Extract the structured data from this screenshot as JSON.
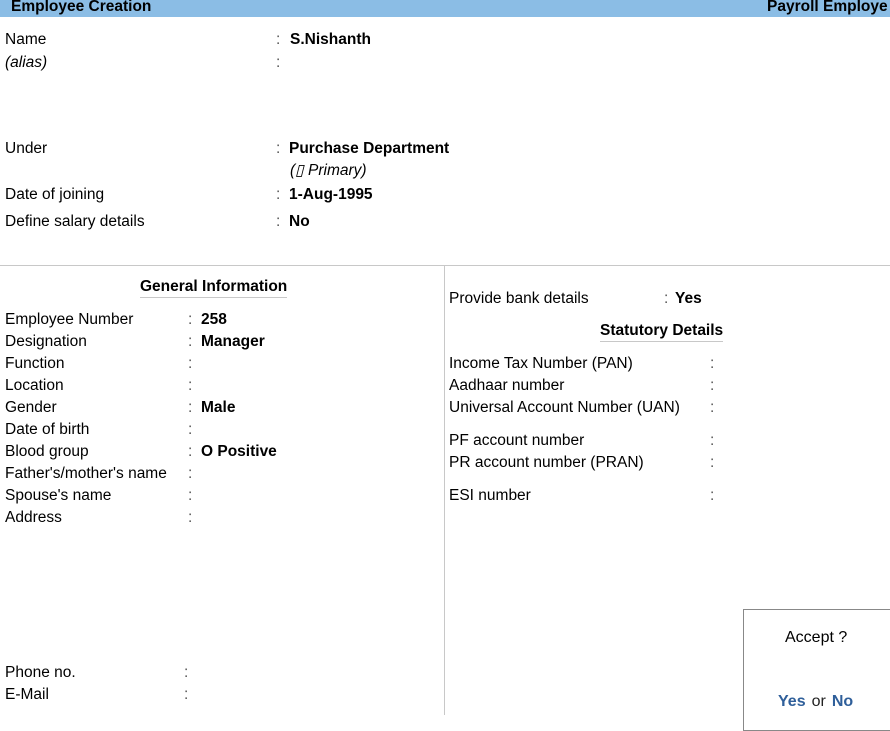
{
  "header": {
    "title": "Employee  Creation",
    "right_title": "Payroll Employe"
  },
  "top_fields": {
    "name": {
      "label": "Name",
      "value": "S.Nishanth"
    },
    "alias": {
      "label": "(alias)",
      "value": ""
    },
    "under": {
      "label": "Under",
      "value": "Purchase Department",
      "sub": "(▯  Primary)"
    },
    "date_of_joining": {
      "label": "Date of joining",
      "value": "1-Aug-1995"
    },
    "define_salary": {
      "label": "Define salary details",
      "value": "No"
    }
  },
  "general_info": {
    "title": "General Information",
    "fields": [
      {
        "label": "Employee Number",
        "value": "258"
      },
      {
        "label": "Designation",
        "value": "Manager"
      },
      {
        "label": "Function",
        "value": ""
      },
      {
        "label": "Location",
        "value": ""
      },
      {
        "label": "Gender",
        "value": "Male"
      },
      {
        "label": "Date of birth",
        "value": ""
      },
      {
        "label": "Blood group",
        "value": "O Positive"
      },
      {
        "label": "Father's/mother's name",
        "value": ""
      },
      {
        "label": "Spouse's name",
        "value": ""
      },
      {
        "label": "Address",
        "value": ""
      }
    ],
    "phone": {
      "label": "Phone no.",
      "value": ""
    },
    "email": {
      "label": "E-Mail",
      "value": ""
    }
  },
  "right_panel": {
    "bank": {
      "label": "Provide bank details",
      "value": "Yes"
    },
    "statutory_title": "Statutory Details",
    "fields": [
      {
        "label": "Income Tax Number (PAN)",
        "value": ""
      },
      {
        "label": "Aadhaar number",
        "value": ""
      },
      {
        "label": "Universal Account Number (UAN)",
        "value": ""
      },
      {
        "label": "PF account number",
        "value": ""
      },
      {
        "label": "PR account number (PRAN)",
        "value": ""
      },
      {
        "label": "ESI number",
        "value": ""
      }
    ]
  },
  "dialog": {
    "question": "Accept ?",
    "yes": "Yes",
    "or": "or",
    "no": "No"
  },
  "colon": ":"
}
